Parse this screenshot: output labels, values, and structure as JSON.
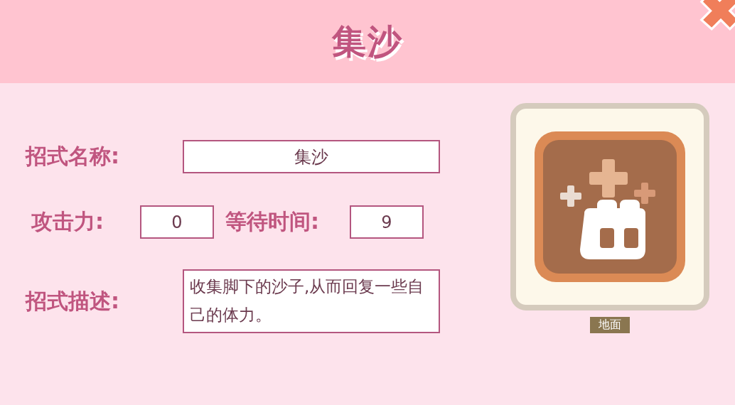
{
  "header": {
    "title": "集沙"
  },
  "skill_name": {
    "label": "招式名称:",
    "value": "集沙"
  },
  "attack": {
    "label": "攻击力:",
    "value": "0"
  },
  "wait_time": {
    "label": "等待时间:",
    "value": "9"
  },
  "description": {
    "label": "招式描述:",
    "value": "收集脚下的沙子,从而回复一些自己的体力。"
  },
  "skill_card": {
    "type_tag": "地面"
  }
}
